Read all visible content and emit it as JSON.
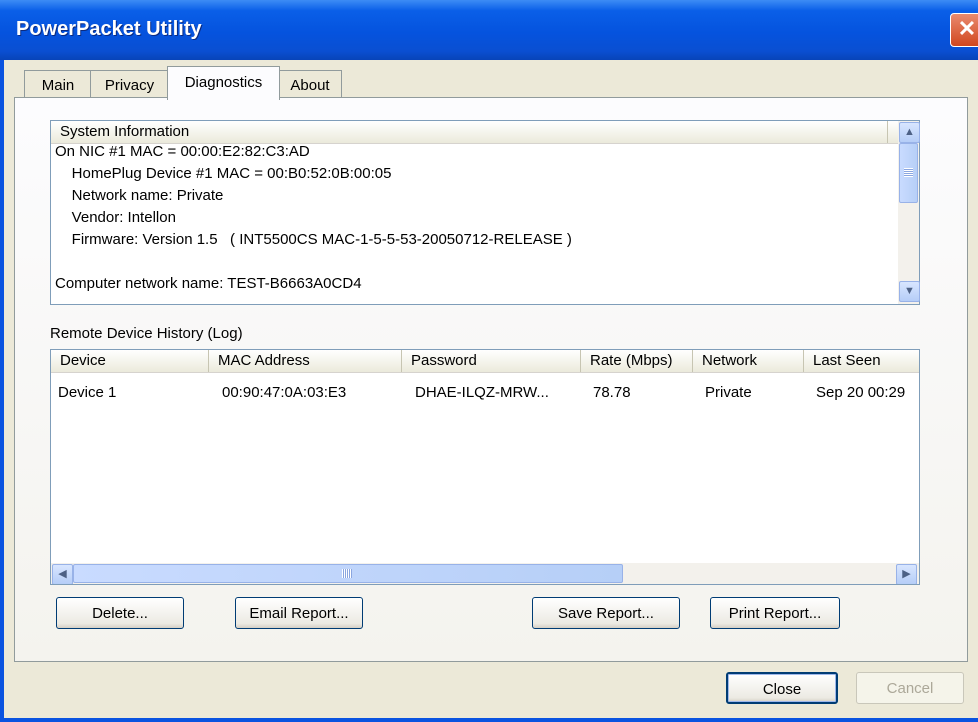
{
  "window": {
    "title": "PowerPacket Utility",
    "close_glyph": "✕"
  },
  "tabs": [
    {
      "label": "Main"
    },
    {
      "label": "Privacy"
    },
    {
      "label": "Diagnostics"
    },
    {
      "label": "About"
    }
  ],
  "system_info": {
    "header": "System Information",
    "lines": [
      "On NIC #1 MAC = 00:00:E2:82:C3:AD",
      "    HomePlug Device #1 MAC = 00:B0:52:0B:00:05",
      "    Network name: Private",
      "    Vendor: Intellon",
      "    Firmware: Version 1.5   ( INT5500CS MAC-1-5-5-53-20050712-RELEASE )",
      "",
      "Computer network name: TEST-B6663A0CD4"
    ]
  },
  "log": {
    "label": "Remote Device History (Log)",
    "columns": [
      "Device",
      "MAC Address",
      "Password",
      "Rate (Mbps)",
      "Network",
      "Last Seen"
    ],
    "rows": [
      [
        "Device 1",
        "00:90:47:0A:03:E3",
        "DHAE-ILQZ-MRW...",
        "78.78",
        "Private",
        "Sep 20 00:29"
      ]
    ]
  },
  "buttons": {
    "delete": "Delete...",
    "email": "Email Report...",
    "save": "Save Report...",
    "print": "Print Report...",
    "close": "Close",
    "cancel": "Cancel"
  },
  "icons": {
    "close": "close-icon",
    "scroll_up": "scroll-up-arrow-icon",
    "scroll_down": "scroll-down-arrow-icon",
    "scroll_left": "scroll-left-arrow-icon",
    "scroll_right": "scroll-right-arrow-icon",
    "grip": "scroll-grip-icon"
  }
}
